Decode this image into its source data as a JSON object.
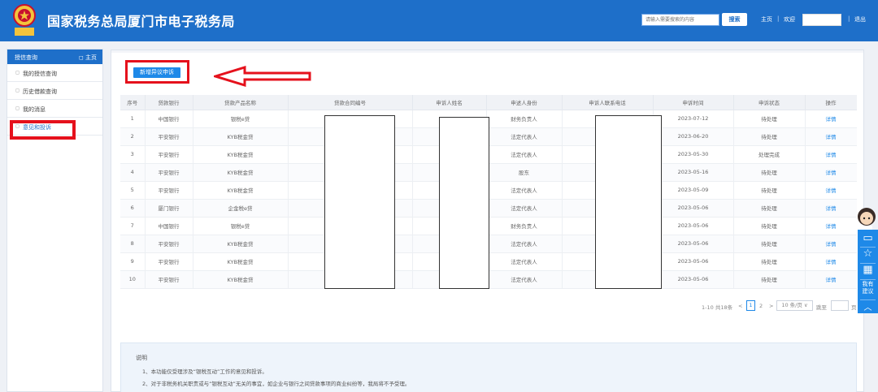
{
  "header": {
    "title": "国家税务总局厦门市电子税务局",
    "search_placeholder": "请输入需要搜索的内容",
    "search_button": "搜索",
    "home_link": "主页",
    "welcome": "欢迎",
    "logout": "退出",
    "separator": "|",
    "emblem_text": "中国税务"
  },
  "sidebar": {
    "title": "授信查询",
    "home": "主页",
    "items": [
      {
        "label": "我的授信查询"
      },
      {
        "label": "历史借款查询"
      },
      {
        "label": "我的消息"
      },
      {
        "label": "意见和投诉"
      }
    ]
  },
  "main": {
    "add_button": "新增异议申诉",
    "columns": [
      "序号",
      "贷款银行",
      "贷款产品名称",
      "贷款合同编号",
      "申诉人姓名",
      "申述人身份",
      "申诉人联系电话",
      "申诉时间",
      "申诉状态",
      "操作"
    ],
    "rows": [
      [
        "1",
        "中国银行",
        "银税e贷",
        "",
        "",
        "财务负责人",
        "",
        "2023-07-12",
        "待处理",
        "详情"
      ],
      [
        "2",
        "平安银行",
        "KYB税金贷",
        "",
        "",
        "法定代表人",
        "",
        "2023-06-20",
        "待处理",
        "详情"
      ],
      [
        "3",
        "平安银行",
        "KYB税金贷",
        "",
        "",
        "法定代表人",
        "",
        "2023-05-30",
        "处理完成",
        "详情"
      ],
      [
        "4",
        "平安银行",
        "KYB税金贷",
        "",
        "",
        "股东",
        "",
        "2023-05-16",
        "待处理",
        "详情"
      ],
      [
        "5",
        "平安银行",
        "KYB税金贷",
        "",
        "",
        "法定代表人",
        "",
        "2023-05-09",
        "待处理",
        "详情"
      ],
      [
        "6",
        "厦门银行",
        "企金税e贷",
        "",
        "",
        "法定代表人",
        "",
        "2023-05-06",
        "待处理",
        "详情"
      ],
      [
        "7",
        "中国银行",
        "银税e贷",
        "",
        "",
        "财务负责人",
        "",
        "2023-05-06",
        "待处理",
        "详情"
      ],
      [
        "8",
        "平安银行",
        "KYB税金贷",
        "",
        "",
        "法定代表人",
        "",
        "2023-05-06",
        "待处理",
        "详情"
      ],
      [
        "9",
        "平安银行",
        "KYB税金贷",
        "",
        "",
        "法定代表人",
        "",
        "2023-05-06",
        "待处理",
        "详情"
      ],
      [
        "10",
        "平安银行",
        "KYB税金贷",
        "",
        "",
        "法定代表人",
        "",
        "2023-05-06",
        "待处理",
        "详情"
      ]
    ],
    "pager": {
      "summary": "1-10 共18条",
      "prev": "<",
      "page1": "1",
      "page2": "2",
      "next": ">",
      "page_size": "10 条/页 ∨",
      "jump_label": "跳至",
      "page_suffix": "页"
    },
    "notes": {
      "title": "说明",
      "line1": "1、本功能仅受理涉及“银税互动”工作的意见和投诉。",
      "line2": "2、对于非税务机关职责或与“银税互动”无关的事宜，如企业与银行之间贷款事项的商业纠纷等，我局将不予受理。"
    }
  },
  "float_widget": {
    "suggest": "我有建议",
    "up": "︿"
  },
  "colors": {
    "brand_blue": "#1e6fc9",
    "link_blue": "#1e89e8",
    "annotation_red": "#e5111c"
  },
  "icons": [
    "national-tax-emblem-icon",
    "chat-icon",
    "star-icon",
    "calculator-icon",
    "arrow-up-icon",
    "customer-service-avatar-icon",
    "red-arrow-annotation-icon"
  ]
}
